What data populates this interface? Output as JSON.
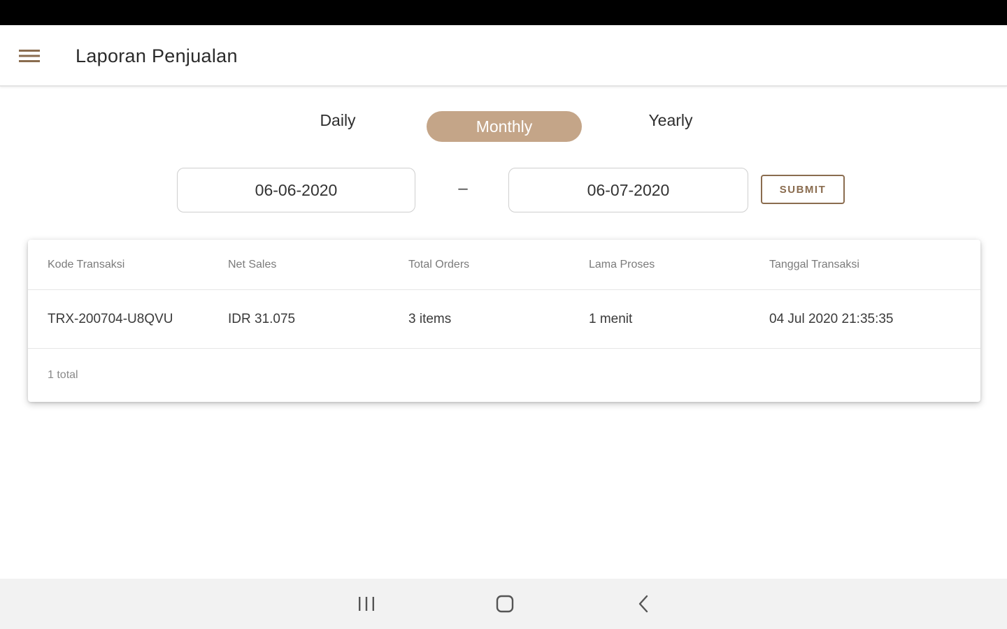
{
  "app_bar": {
    "title": "Laporan Penjualan",
    "menu_icon": "hamburger-menu-icon"
  },
  "period_tabs": {
    "daily": "Daily",
    "monthly": "Monthly",
    "yearly": "Yearly",
    "selected": "Monthly"
  },
  "date_range": {
    "start": "06-06-2020",
    "separator": "–",
    "end": "06-07-2020",
    "submit_label": "SUBMIT"
  },
  "table": {
    "headers": [
      "Kode Transaksi",
      "Net Sales",
      "Total Orders",
      "Lama Proses",
      "Tanggal Transaksi"
    ],
    "rows": [
      [
        "TRX-200704-U8QVU",
        "IDR 31.075",
        "3 items",
        "1 menit",
        "04 Jul 2020 21:35:35"
      ]
    ],
    "footer": "1 total"
  },
  "colors": {
    "accent": "#c4a588",
    "accent_dark": "#8a6c4f",
    "status_bar": "#000000",
    "nav_bar": "#f2f2f2"
  },
  "nav_bar": {
    "icons": [
      "recent-apps-icon",
      "home-icon",
      "back-icon"
    ]
  }
}
